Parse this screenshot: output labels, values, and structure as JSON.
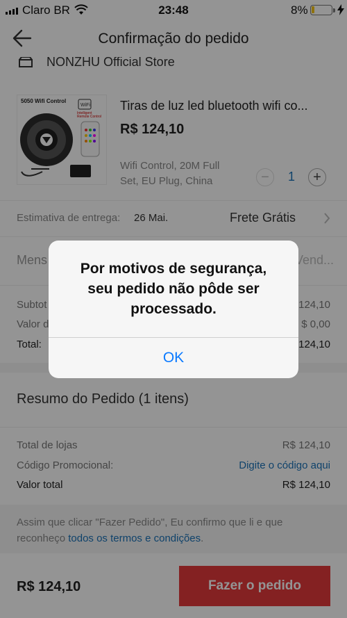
{
  "status_bar": {
    "carrier": "Claro BR",
    "time": "23:48",
    "battery": "8%"
  },
  "nav": {
    "title": "Confirmação do pedido"
  },
  "store": {
    "name": "NONZHU Official Store"
  },
  "product": {
    "image_label": "5050 Wifi Control",
    "title": "Tiras de luz led bluetooth wifi co...",
    "price": "R$ 124,10",
    "variant_line1": "Wifi Control, 20M Full",
    "variant_line2": "Set, EU Plug, China",
    "quantity": "1",
    "minus_label": "−",
    "plus_label": "+"
  },
  "delivery": {
    "label": "Estimativa de entrega:",
    "date": "26 Mai.",
    "shipping": "Frete Grátis"
  },
  "message": {
    "label": "Mens",
    "placeholder_tail": "o Vend..."
  },
  "totals": {
    "subtotal_label": "Subtot",
    "subtotal_value": "124,10",
    "shipping_label": "Valor d",
    "shipping_value": "$ 0,00",
    "total_label": "Total:",
    "total_value": "124,10"
  },
  "summary": {
    "heading": "Resumo do Pedido (1 itens)",
    "store_total_label": "Total de lojas",
    "store_total_value": "R$ 124,10",
    "promo_label": "Código Promocional:",
    "promo_link": "Digite o código aqui",
    "total_label": "Valor total",
    "total_value": "R$ 124,10"
  },
  "terms": {
    "text_line1": "Assim que clicar \"Fazer Pedido\", Eu confirmo que li e que",
    "text_line2_prefix": "reconheço ",
    "link": "todos os termos e condições",
    "suffix": "."
  },
  "bottom": {
    "total": "R$ 124,10",
    "button": "Fazer o pedido",
    "button_color": "#e4393c"
  },
  "alert": {
    "message": "Por motivos de segurança,\nseu pedido não pôde ser\nprocessado.",
    "ok": "OK"
  },
  "colors": {
    "accent_link": "#1a73b8",
    "ios_blue": "#0a7aff"
  }
}
